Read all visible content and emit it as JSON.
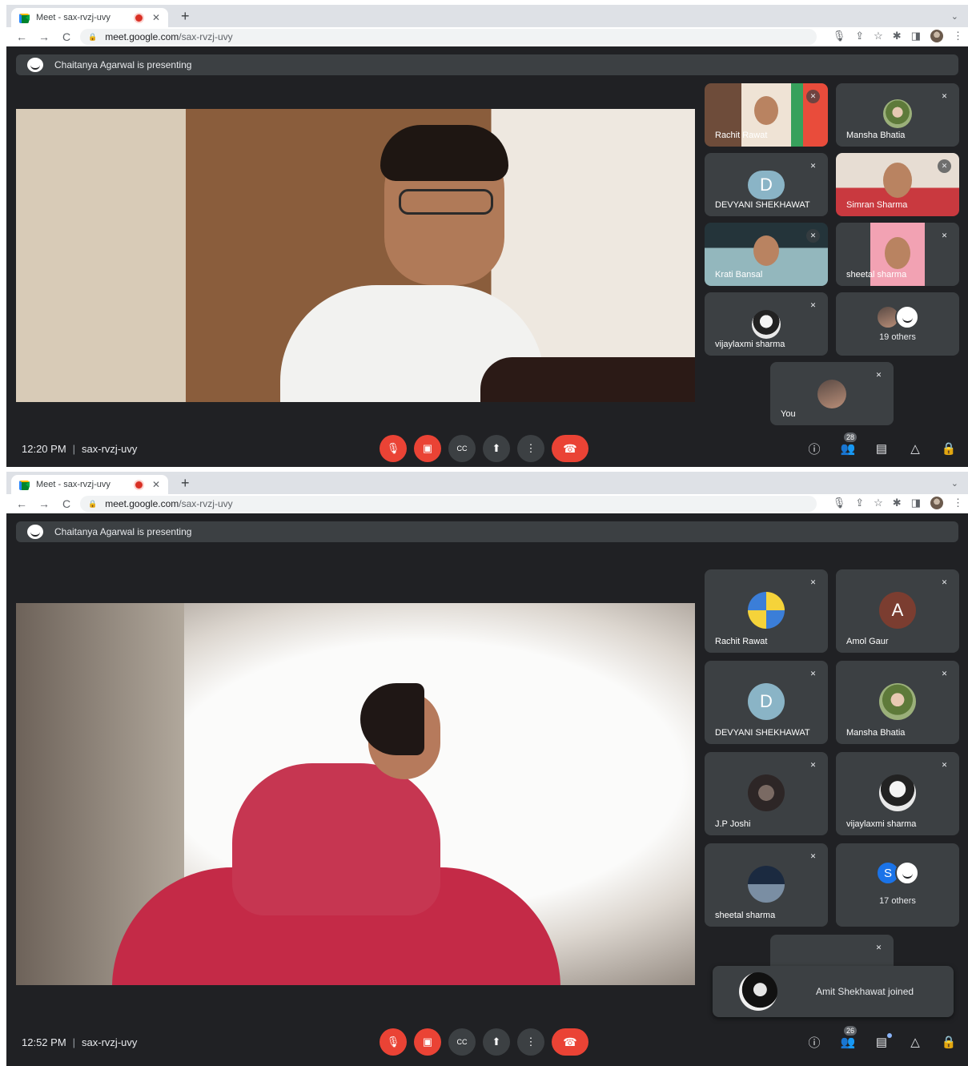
{
  "screens": [
    {
      "tab": {
        "title": "Meet - sax-rvzj-uvy",
        "close": "✕",
        "new_tab": "+"
      },
      "address": {
        "host": "meet.google.com",
        "path": "/sax-rvzj-uvy"
      },
      "banner": {
        "text": "Chaitanya Agarwal is presenting"
      },
      "tiles": [
        {
          "name": "Rachit Rawat"
        },
        {
          "name": "Mansha Bhatia"
        },
        {
          "name": "DEVYANI SHEKHAWAT",
          "initial": "D"
        },
        {
          "name": "Simran Sharma"
        },
        {
          "name": "Krati Bansal"
        },
        {
          "name": "sheetal sharma"
        },
        {
          "name": "vijaylaxmi sharma"
        },
        {
          "label": "19 others"
        },
        {
          "name": "You"
        }
      ],
      "bottom": {
        "time": "12:20 PM",
        "separator": "|",
        "meeting_code": "sax-rvzj-uvy",
        "participant_count": "28"
      }
    },
    {
      "tab": {
        "title": "Meet - sax-rvzj-uvy",
        "close": "✕",
        "new_tab": "+"
      },
      "address": {
        "host": "meet.google.com",
        "path": "/sax-rvzj-uvy"
      },
      "banner": {
        "text": "Chaitanya Agarwal is presenting"
      },
      "tiles": [
        {
          "name": "Rachit Rawat"
        },
        {
          "name": "Amol Gaur",
          "initial": "A"
        },
        {
          "name": "DEVYANI SHEKHAWAT",
          "initial": "D"
        },
        {
          "name": "Mansha Bhatia"
        },
        {
          "name": "J.P Joshi"
        },
        {
          "name": "vijaylaxmi sharma"
        },
        {
          "name": "sheetal sharma"
        },
        {
          "label": "17 others",
          "initial": "S"
        }
      ],
      "toast": {
        "text": "Amit Shekhawat joined"
      },
      "bottom": {
        "time": "12:52 PM",
        "separator": "|",
        "meeting_code": "sax-rvzj-uvy",
        "participant_count": "26"
      }
    }
  ],
  "icons": {
    "back": "←",
    "forward": "→",
    "reload": "C",
    "lock": "🔒",
    "mic": "🎙",
    "share": "⇪",
    "star": "☆",
    "extensions": "✱",
    "sidepanel": "◨",
    "menu": "⋮",
    "mic_off": "🎙",
    "cam_off": "▣",
    "captions": "CC",
    "present": "⬆",
    "more": "⋮",
    "end_call": "☎",
    "info": "ⓘ",
    "people": "👥",
    "chat": "▤",
    "activities": "△",
    "host_controls": "🔒",
    "muted": "✕"
  },
  "colors": {
    "meet_bg": "#202124",
    "tile_bg": "#3c4043",
    "red": "#ea4335",
    "text": "#e8eaed"
  }
}
